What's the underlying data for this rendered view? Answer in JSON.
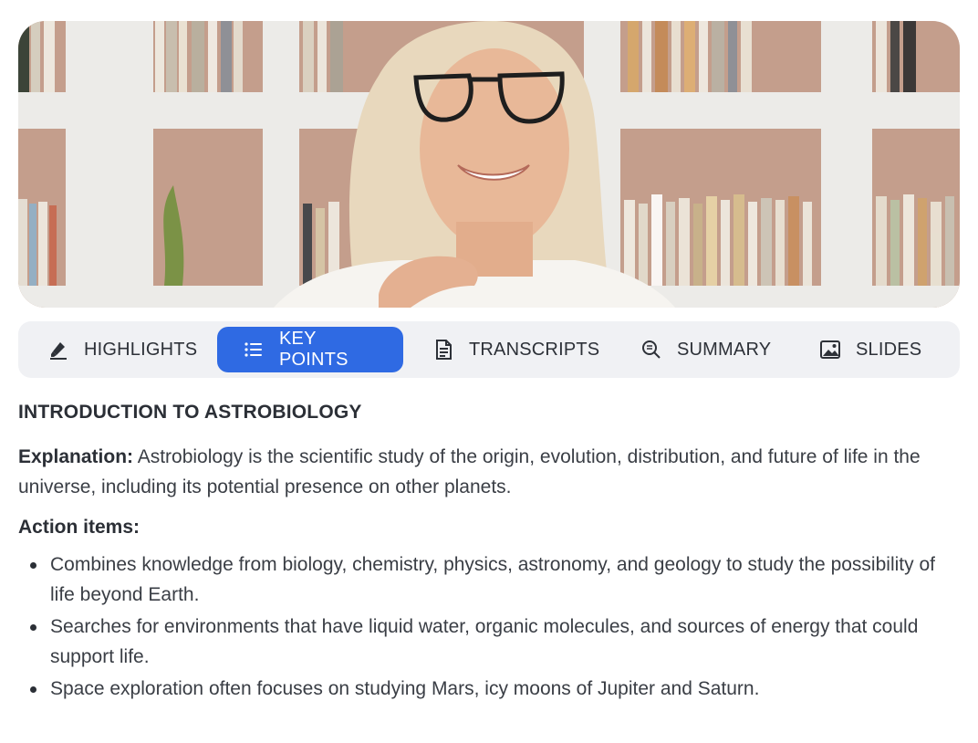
{
  "video": {
    "thumbnail_alt": "Instructor speaking in front of bookshelves",
    "icon": "video-thumbnail"
  },
  "tabs": [
    {
      "label": "HIGHLIGHTS",
      "icon": "highlighter-icon",
      "active": false
    },
    {
      "label": "KEY POINTS",
      "icon": "list-icon",
      "active": true
    },
    {
      "label": "TRANSCRIPTS",
      "icon": "document-icon",
      "active": false
    },
    {
      "label": "SUMMARY",
      "icon": "search-document-icon",
      "active": false
    },
    {
      "label": "SLIDES",
      "icon": "image-icon",
      "active": false
    }
  ],
  "content": {
    "title": "INTRODUCTION TO ASTROBIOLOGY",
    "explanation_label": "Explanation:",
    "explanation_text": " Astrobiology is the scientific study of the origin, evolution, distribution, and future of life in the universe, including its potential presence on other planets.",
    "actions_title": "Action items:",
    "action_items": [
      "Combines knowledge from biology, chemistry, physics, astronomy, and geology to study the possibility of life beyond Earth.",
      "Searches for environments that have liquid water, organic molecules, and sources of energy that could support life.",
      "Space exploration often focuses on studying Mars, icy moons of Jupiter and Saturn."
    ]
  },
  "colors": {
    "accent": "#2f6ae3",
    "tab_bar_bg": "#f0f1f4",
    "text": "#2b2f36"
  }
}
